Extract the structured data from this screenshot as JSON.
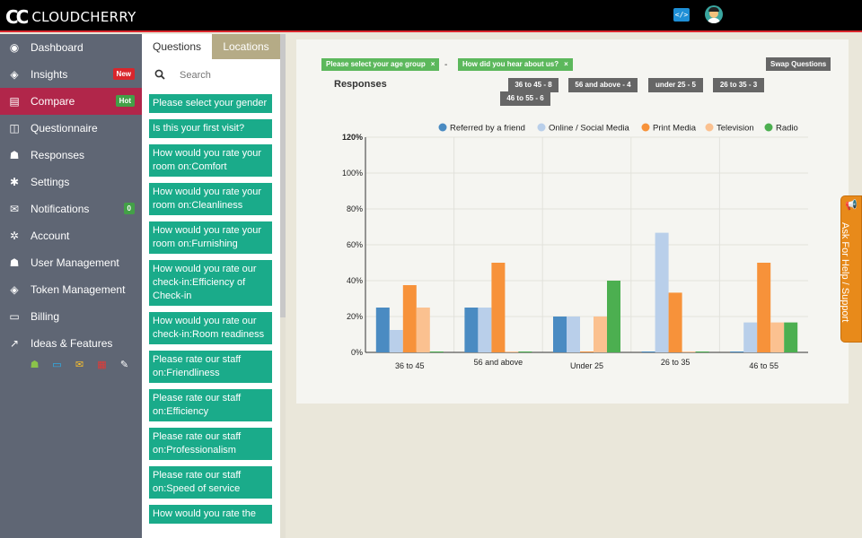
{
  "app": {
    "brand": "CLOUDCHERRY",
    "logo_mark": "CC"
  },
  "topbar": {
    "code_icon": "code-icon",
    "avatar": "user-avatar"
  },
  "sidebar": {
    "items": [
      {
        "label": "Dashboard",
        "icon": "dashboard-icon",
        "glyph": "◉"
      },
      {
        "label": "Insights",
        "icon": "eye-icon",
        "glyph": "◈",
        "badge": "New"
      },
      {
        "label": "Compare",
        "icon": "bar-chart-icon",
        "glyph": "▤",
        "badge": "Hot",
        "active": true
      },
      {
        "label": "Questionnaire",
        "icon": "columns-icon",
        "glyph": "◫"
      },
      {
        "label": "Responses",
        "icon": "users-icon",
        "glyph": "☗"
      },
      {
        "label": "Settings",
        "icon": "gear-icon",
        "glyph": "✱"
      },
      {
        "label": "Notifications",
        "icon": "envelope-icon",
        "glyph": "✉",
        "badge": "0"
      },
      {
        "label": "Account",
        "icon": "cogs-icon",
        "glyph": "✲"
      },
      {
        "label": "User Management",
        "icon": "user-group-icon",
        "glyph": "☗"
      },
      {
        "label": "Token Management",
        "icon": "tag-icon",
        "glyph": "◈"
      },
      {
        "label": "Billing",
        "icon": "credit-card-icon",
        "glyph": "▭"
      },
      {
        "label": "Ideas & Features",
        "icon": "external-link-icon",
        "glyph": "↗"
      }
    ],
    "platforms": [
      {
        "icon": "apple-icon",
        "glyph": "",
        "color": "#ffffff"
      },
      {
        "icon": "android-icon",
        "glyph": "☗",
        "color": "#8bc34a"
      },
      {
        "icon": "laptop-icon",
        "glyph": "▭",
        "color": "#29b6f6"
      },
      {
        "icon": "mail-icon",
        "glyph": "✉",
        "color": "#fbc02d"
      },
      {
        "icon": "qr-code-icon",
        "glyph": "▦",
        "color": "#e53935"
      },
      {
        "icon": "edit-icon",
        "glyph": "✎",
        "color": "#ffffff"
      }
    ]
  },
  "questions_panel": {
    "tabs": [
      "Questions",
      "Locations"
    ],
    "search_placeholder": "Search",
    "items": [
      "Please select your gender",
      "Is this your first visit?",
      "How would you rate your room on:Comfort",
      "How would you rate your room on:Cleanliness",
      "How would you rate your room on:Furnishing",
      "How would you rate our check-in:Efficiency of Check-in",
      "How would you rate our check-in:Room readiness",
      "Please rate our staff on:Friendliness",
      "Please rate our staff on:Efficiency",
      "Please rate our staff on:Professionalism",
      "Please rate our staff on:Speed of service",
      "How would you rate the"
    ]
  },
  "compare": {
    "filter_a": "Please select your age group",
    "filter_b": "How did you hear about us?",
    "separator": "-",
    "close_glyph": "×",
    "swap_label": "Swap Questions",
    "title": "Responses",
    "counts": [
      "36 to 45 - 8",
      "56 and above - 4",
      "under 25 - 5",
      "26 to 35 - 3",
      "46 to 55 - 6"
    ]
  },
  "help": {
    "label": "Ask For Help / Support"
  },
  "chart_data": {
    "type": "bar",
    "categories": [
      "36 to 45",
      "56 and above",
      "Under 25",
      "26 to 35",
      "46 to 55"
    ],
    "series": [
      {
        "name": "Referred by a friend",
        "color": "#4a8bc2",
        "values": [
          25,
          25,
          20,
          0,
          0
        ]
      },
      {
        "name": "Online / Social Media",
        "color": "#b9cfea",
        "values": [
          12.5,
          25,
          20,
          66.7,
          16.7
        ]
      },
      {
        "name": "Print Media",
        "color": "#f7923a",
        "values": [
          37.5,
          50,
          0,
          33.3,
          50
        ]
      },
      {
        "name": "Television",
        "color": "#fbc190",
        "values": [
          25,
          0,
          20,
          0,
          16.7
        ]
      },
      {
        "name": "Radio",
        "color": "#4caf50",
        "values": [
          0,
          0,
          40,
          0,
          16.7
        ]
      }
    ],
    "yticks": [
      "0%",
      "20%",
      "40%",
      "60%",
      "80%",
      "100%",
      "120%"
    ],
    "ylim": [
      0,
      120
    ],
    "legend": "top-right",
    "grid": true
  }
}
